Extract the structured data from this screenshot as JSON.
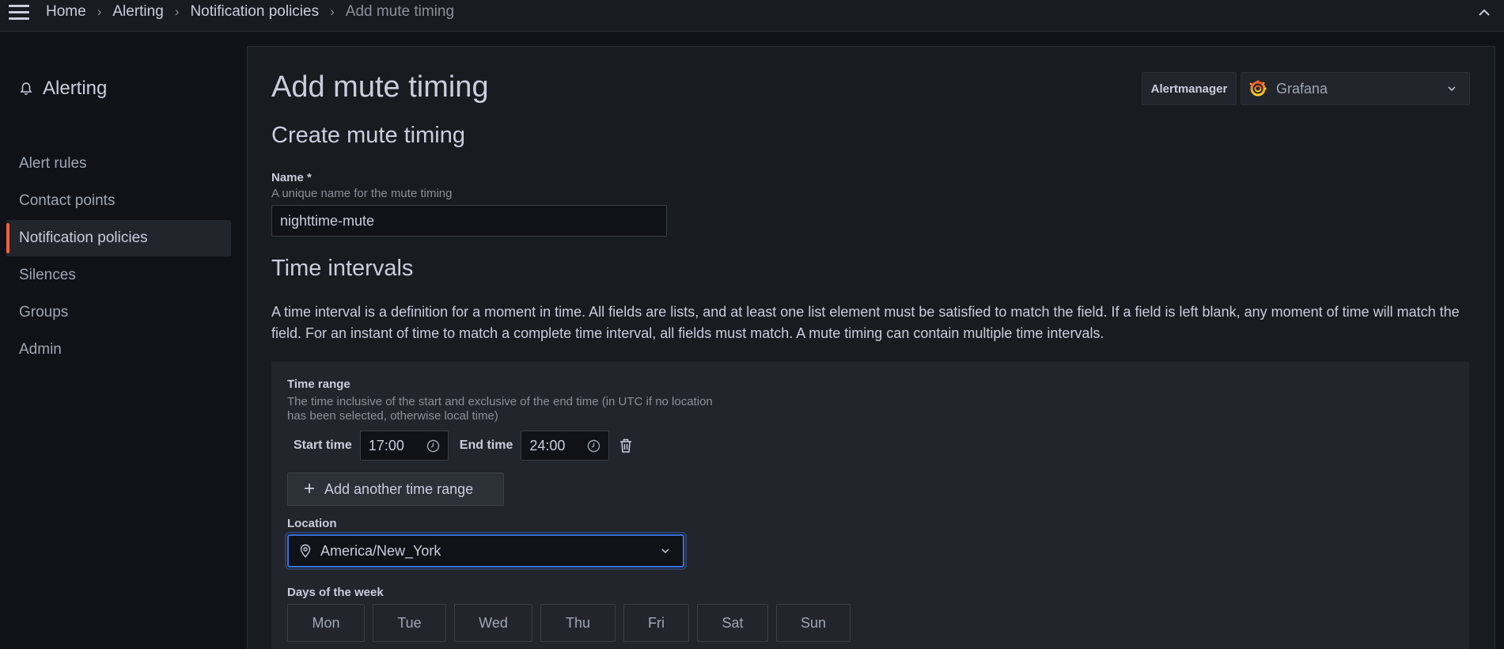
{
  "breadcrumbs": [
    "Home",
    "Alerting",
    "Notification policies",
    "Add mute timing"
  ],
  "sidebar": {
    "title": "Alerting",
    "items": [
      {
        "label": "Alert rules",
        "active": false
      },
      {
        "label": "Contact points",
        "active": false
      },
      {
        "label": "Notification policies",
        "active": true
      },
      {
        "label": "Silences",
        "active": false
      },
      {
        "label": "Groups",
        "active": false
      },
      {
        "label": "Admin",
        "active": false
      }
    ]
  },
  "page": {
    "title": "Add mute timing",
    "alertmanager_label": "Alertmanager",
    "alertmanager_value": "Grafana",
    "section_title": "Create mute timing",
    "name_label": "Name *",
    "name_description": "A unique name for the mute timing",
    "name_value": "nighttime-mute",
    "intervals_title": "Time intervals",
    "intervals_intro": "A time interval is a definition for a moment in time. All fields are lists, and at least one list element must be satisfied to match the field. If a field is left blank, any moment of time will match the field. For an instant of time to match a complete time interval, all fields must match. A mute timing can contain multiple time intervals."
  },
  "interval": {
    "time_range_label": "Time range",
    "time_range_desc_line1": "The time inclusive of the start and exclusive of the end time (in UTC if no location",
    "time_range_desc_line2": "has been selected, otherwise local time)",
    "start_label": "Start time",
    "start_value": "17:00",
    "end_label": "End time",
    "end_value": "24:00",
    "add_range_label": "Add another time range",
    "location_label": "Location",
    "location_value": "America/New_York",
    "days_label": "Days of the week",
    "days": [
      "Mon",
      "Tue",
      "Wed",
      "Thu",
      "Fri",
      "Sat",
      "Sun"
    ]
  },
  "colors": {
    "accent": "#f55f3e",
    "focus": "#3d71d9",
    "background": "#111217",
    "panel": "#181b1f"
  }
}
